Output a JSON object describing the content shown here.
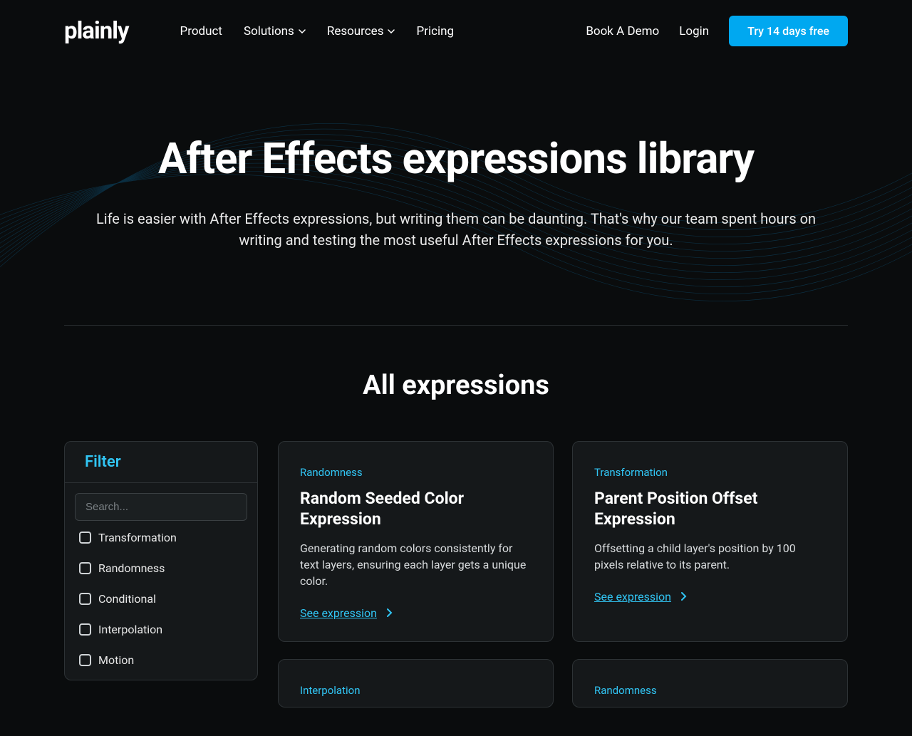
{
  "brand": "plainly",
  "nav": {
    "items": [
      {
        "label": "Product",
        "dropdown": false
      },
      {
        "label": "Solutions",
        "dropdown": true
      },
      {
        "label": "Resources",
        "dropdown": true
      },
      {
        "label": "Pricing",
        "dropdown": false
      }
    ],
    "book_demo": "Book A Demo",
    "login": "Login",
    "cta": "Try 14 days free"
  },
  "hero": {
    "title": "After Effects expressions library",
    "subtitle": "Life is easier with After Effects expressions, but writing them can be daunting. That's why our team spent hours on writing and testing the most useful After Effects expressions for you."
  },
  "section_title": "All expressions",
  "filter": {
    "title": "Filter",
    "search_placeholder": "Search...",
    "options": [
      "Transformation",
      "Randomness",
      "Conditional",
      "Interpolation",
      "Motion"
    ]
  },
  "cards": [
    {
      "tag": "Randomness",
      "title": "Random Seeded Color Expression",
      "desc": "Generating random colors consistently for text layers, ensuring each layer gets a unique color.",
      "link": "See expression"
    },
    {
      "tag": "Transformation",
      "title": "Parent Position Offset Expression",
      "desc": "Offsetting a child layer's position by 100 pixels relative to its parent.",
      "link": "See expression"
    }
  ],
  "cards_partial": [
    {
      "tag": "Interpolation"
    },
    {
      "tag": "Randomness"
    }
  ]
}
